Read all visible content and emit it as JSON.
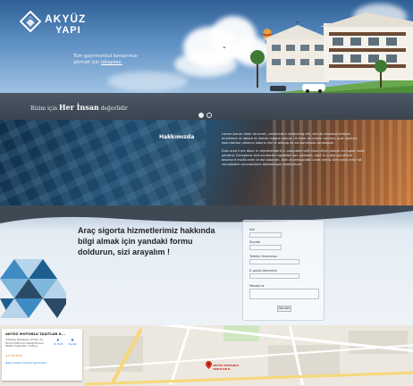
{
  "brand": {
    "name_line1": "AKYÜZ",
    "name_line2": "YAPI"
  },
  "hero": {
    "promo_text": "Tüm gayrimenkul ilanlarımızı görmek için",
    "promo_link": "tıklayınız."
  },
  "slogan": {
    "pre": "Bizim için",
    "big": "Her İnsan",
    "post": "değerlidir"
  },
  "slider": {
    "dot_count": 2,
    "active_index": 0
  },
  "about": {
    "title": "Hakkımızda",
    "paragraph1": "Lorem ipsum dolor sit amet, consectetur adipiscing elit, sed do eiusmod tempor incididunt ut labore et dolore magna aliqua. Ut enim ad minim veniam, quis nostrud exercitation ullamco laboris nisi ut aliquip ex ea commodo consequat.",
    "paragraph2": "Duis aute irure dolor in reprehenderit in voluptate velit esse cillum dolore eu fugiat nulla pariatur. Excepteur sint occaecat cupidatat non proident, sunt in culpa qui officia deserunt mollit anim id est laborum. Sed ut perspiciatis unde omnis iste natus error sit voluptatem accusantium doloremque laudantium."
  },
  "contact": {
    "heading": "Araç sigorta hizmetlerimiz hakkında bilgi almak için yandaki formu doldurun, sizi arayalım !",
    "form": {
      "name_label": "Adı",
      "surname_label": "Soyadı",
      "phone_label": "Telefon Numarası",
      "email_label": "E-posta Adresiniz",
      "message_label": "Mesajınız",
      "submit_label": "Gönder"
    }
  },
  "map": {
    "card_title": "AKYÜZ MOTORLU TAŞITLAR K...",
    "address": "Ortakapı Mahallesi, 67741. Sk. Fenerli Mahmut Gökalp Bulvarı, 65000 Tuşba/Van, Türkiye",
    "rating": "4.5 ★★★★★",
    "reviews_link": "Daha büyük haritayı görüntüle",
    "directions_label": "Yol Tarifi",
    "save_label": "Kaydet",
    "pin_label": "AKYÜZ MOTORLU TAŞITLAR K.",
    "colors": {
      "pin": "#d93025",
      "link": "#1a73e8"
    }
  },
  "colors": {
    "dark_bar": "#3f4954",
    "form_border": "#c9d5df",
    "triangle_blues": [
      "#1c5f8f",
      "#3d8bc2",
      "#7fb6dc",
      "#b8d4ea",
      "#2a4a66"
    ]
  }
}
